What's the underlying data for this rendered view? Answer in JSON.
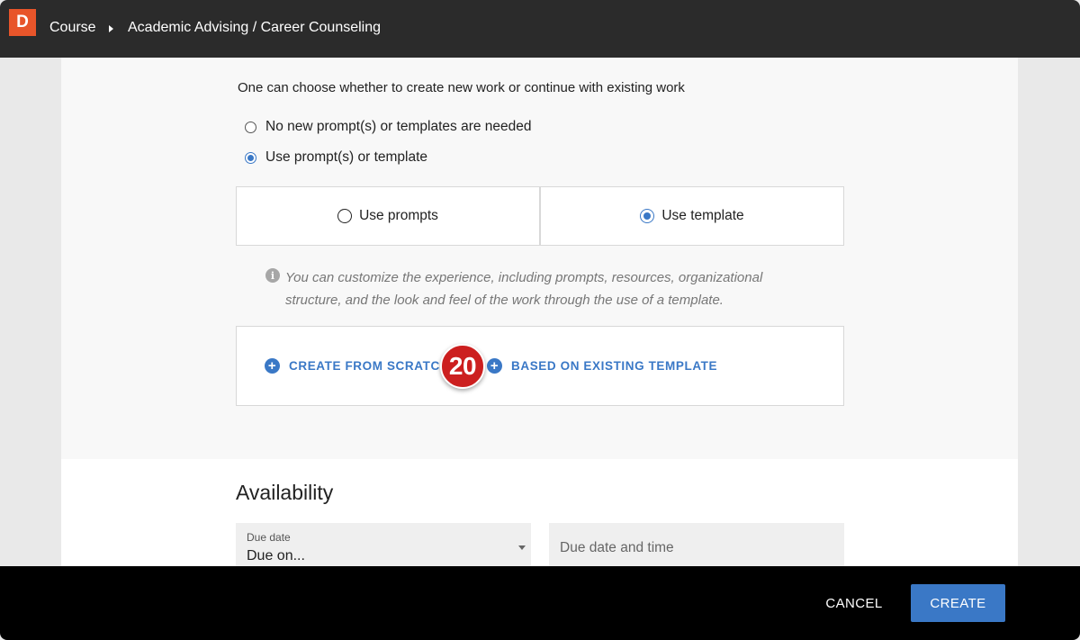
{
  "header": {
    "logo_letter": "D",
    "breadcrumb": [
      "Course",
      "Academic Advising / Career Counseling"
    ]
  },
  "work": {
    "intro": "One can choose whether to create new work or continue with existing work",
    "options": [
      {
        "label": "No new prompt(s) or templates are needed",
        "checked": false
      },
      {
        "label": "Use prompt(s) or template",
        "checked": true
      }
    ],
    "mode_toggle": [
      {
        "label": "Use prompts",
        "checked": false
      },
      {
        "label": "Use template",
        "checked": true
      }
    ],
    "info_text": "You can customize the experience, including prompts, resources, organizational structure, and the look and feel of the work through the use of a template.",
    "create_from_scratch": "CREATE FROM SCRATCH",
    "based_on_existing": "BASED ON EXISTING TEMPLATE",
    "step_badge": "20"
  },
  "availability": {
    "title": "Availability",
    "due_date_label": "Due date",
    "due_date_value": "Due on...",
    "due_datetime_placeholder": "Due date and time"
  },
  "footer": {
    "cancel": "CANCEL",
    "create": "CREATE"
  },
  "colors": {
    "accent": "#3a78c6",
    "logo": "#e8552a",
    "badge": "#cc1f1f",
    "topbar": "#2b2b2b",
    "footer": "#000000"
  }
}
